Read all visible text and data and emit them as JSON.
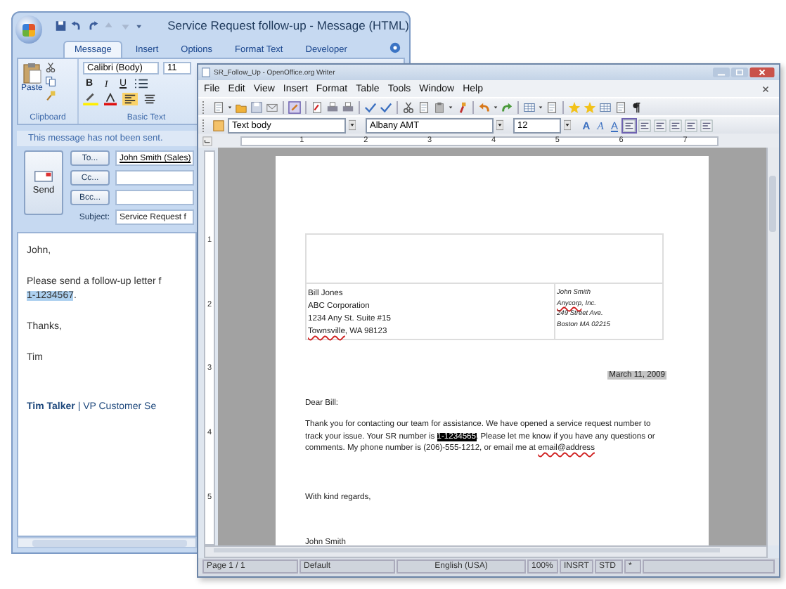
{
  "outlook": {
    "title": "Service Request follow-up - Message (HTML)",
    "tabs": [
      {
        "label": "Message",
        "selected": true
      },
      {
        "label": "Insert",
        "selected": false
      },
      {
        "label": "Options",
        "selected": false
      },
      {
        "label": "Format Text",
        "selected": false
      },
      {
        "label": "Developer",
        "selected": false
      }
    ],
    "clipboard": {
      "paste": "Paste",
      "label": "Clipboard"
    },
    "basic_text": {
      "font": "Calibri (Body)",
      "size": "11",
      "styles": [
        {
          "kind": "bold",
          "text": "B"
        },
        {
          "kind": "italic",
          "text": "I"
        },
        {
          "kind": "underline",
          "text": "U"
        }
      ],
      "label": "Basic Text"
    },
    "info_bar": "This message has not been sent.",
    "send": "Send",
    "recipients": [
      {
        "button": "To...",
        "value": "John Smith (Sales)"
      },
      {
        "button": "Cc..."
      },
      {
        "button": "Bcc..."
      }
    ],
    "subject": {
      "label": "Subject:",
      "value": "Service Request f"
    },
    "body": [
      {
        "lines": [
          [
            {
              "text": "John,",
              "highlighted": false
            }
          ]
        ]
      },
      {
        "lines": [
          [
            {
              "text": "Please send a follow-up letter f",
              "highlighted": false
            }
          ],
          [
            {
              "text": "1-1234567",
              "highlighted": true
            },
            {
              "text": ".",
              "highlighted": false
            }
          ]
        ]
      },
      {
        "lines": [
          [
            {
              "text": "Thanks,",
              "highlighted": false
            }
          ]
        ]
      },
      {
        "lines": [
          [
            {
              "text": "Tim",
              "highlighted": false
            }
          ]
        ]
      }
    ],
    "signature": "**Tim Talker** | VP Customer Se"
  },
  "writer": {
    "title": "SR_Follow_Up - OpenOffice.org Writer",
    "menu": [
      "File",
      "Edit",
      "View",
      "Insert",
      "Format",
      "Table",
      "Tools",
      "Window",
      "Help"
    ],
    "style": "Text body",
    "font": "Albany AMT",
    "size": "12",
    "format_buttons": [
      {
        "kind": "bold",
        "text": "A"
      },
      {
        "kind": "italic",
        "text": "A"
      },
      {
        "kind": "underline",
        "text": "A"
      }
    ],
    "ruler": [
      "1",
      "2",
      "3",
      "4",
      "5",
      "6",
      "7"
    ],
    "vruler": [
      "1",
      "2",
      "3",
      "4",
      "5"
    ],
    "document": {
      "sender": [
        [
          {
            "text": "Bill  Jones",
            "misspelled": false
          }
        ],
        [
          {
            "text": "ABC Corporation",
            "misspelled": false
          }
        ],
        [
          {
            "text": "1234 Any St. Suite #15",
            "misspelled": false
          }
        ],
        [
          {
            "text": "Townsville",
            "misspelled": true
          },
          {
            "text": ", WA 98123",
            "misspelled": false
          }
        ]
      ],
      "recipient": [
        [
          {
            "text": "John Smith",
            "misspelled": false
          }
        ],
        [
          {
            "text": "Anycorp",
            "misspelled": true
          },
          {
            "text": ", Inc.",
            "misspelled": false
          }
        ],
        [
          {
            "text": "249 Street Ave.",
            "misspelled": false
          }
        ],
        [
          {
            "text": "Boston MA 02215",
            "misspelled": false
          }
        ]
      ],
      "date": {
        "text": "March 11, 2009",
        "shaded": true
      },
      "greeting": "Dear Bill:",
      "body": [
        {
          "text": "Thank you for contacting our team for assistance. We have opened a service request number to track your issue.  Your SR number is ",
          "highlighted": false,
          "misspelled": false
        },
        {
          "text": "1-1234565",
          "highlighted": true,
          "misspelled": false
        },
        {
          "text": ". Please let me know if you have any questions or comments. My phone number is  (206)-555-1212, or email me at ",
          "highlighted": false,
          "misspelled": false
        },
        {
          "text": "email@address",
          "highlighted": false,
          "misspelled": true
        }
      ],
      "closing": "With kind regards,",
      "signature": "John Smith"
    },
    "status_bar": [
      "Page 1 / 1",
      "Default",
      "English (USA)",
      "100%",
      "INSRT",
      "STD",
      "*"
    ]
  }
}
